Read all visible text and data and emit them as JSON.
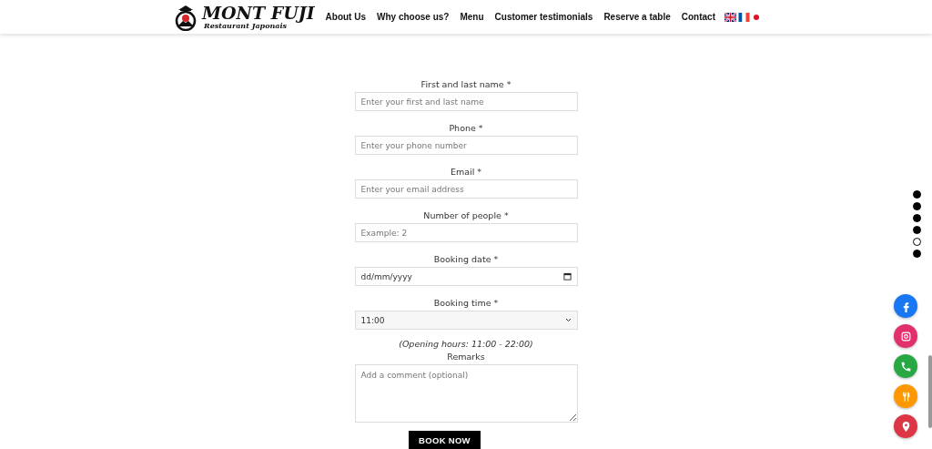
{
  "header": {
    "logo": {
      "name": "MONT FUJI",
      "tagline": "Restaurant Japonais"
    },
    "nav": [
      {
        "label": "About Us"
      },
      {
        "label": "Why choose us?"
      },
      {
        "label": "Menu"
      },
      {
        "label": "Customer testimonials"
      },
      {
        "label": "Reserve a table"
      },
      {
        "label": "Contact"
      }
    ],
    "languages": [
      {
        "kind": "uk"
      },
      {
        "kind": "fr"
      },
      {
        "kind": "jp"
      }
    ]
  },
  "form": {
    "fields": [
      {
        "kind": "text",
        "label": "First and last name *",
        "placeholder": "Enter your first and last name"
      },
      {
        "kind": "text",
        "label": "Phone *",
        "placeholder": "Enter your phone number"
      },
      {
        "kind": "text",
        "label": "Email *",
        "placeholder": "Enter your email address"
      },
      {
        "kind": "text",
        "label": "Number of people *",
        "placeholder": "Example: 2"
      },
      {
        "kind": "date",
        "label": "Booking date *",
        "placeholder": "dd/mm/yyyy"
      },
      {
        "kind": "select",
        "label": "Booking time *",
        "value": "11:00"
      },
      {
        "kind": "note",
        "text": "(Opening hours: 11:00 - 22:00)"
      },
      {
        "kind": "textarea",
        "label": "Remarks",
        "placeholder": "Add a comment (optional)"
      }
    ],
    "submit": "BOOK NOW"
  },
  "section_dots": [
    {
      "selected": false
    },
    {
      "selected": false
    },
    {
      "selected": false
    },
    {
      "selected": false
    },
    {
      "selected": true
    },
    {
      "selected": false
    }
  ],
  "social_buttons": [
    {
      "kind": "facebook",
      "color": "#1877f2"
    },
    {
      "kind": "instagram",
      "color": "#e1306c"
    },
    {
      "kind": "phone",
      "color": "#28a745"
    },
    {
      "kind": "menu",
      "color": "#ff9800"
    },
    {
      "kind": "location",
      "color": "#dc3545"
    }
  ]
}
